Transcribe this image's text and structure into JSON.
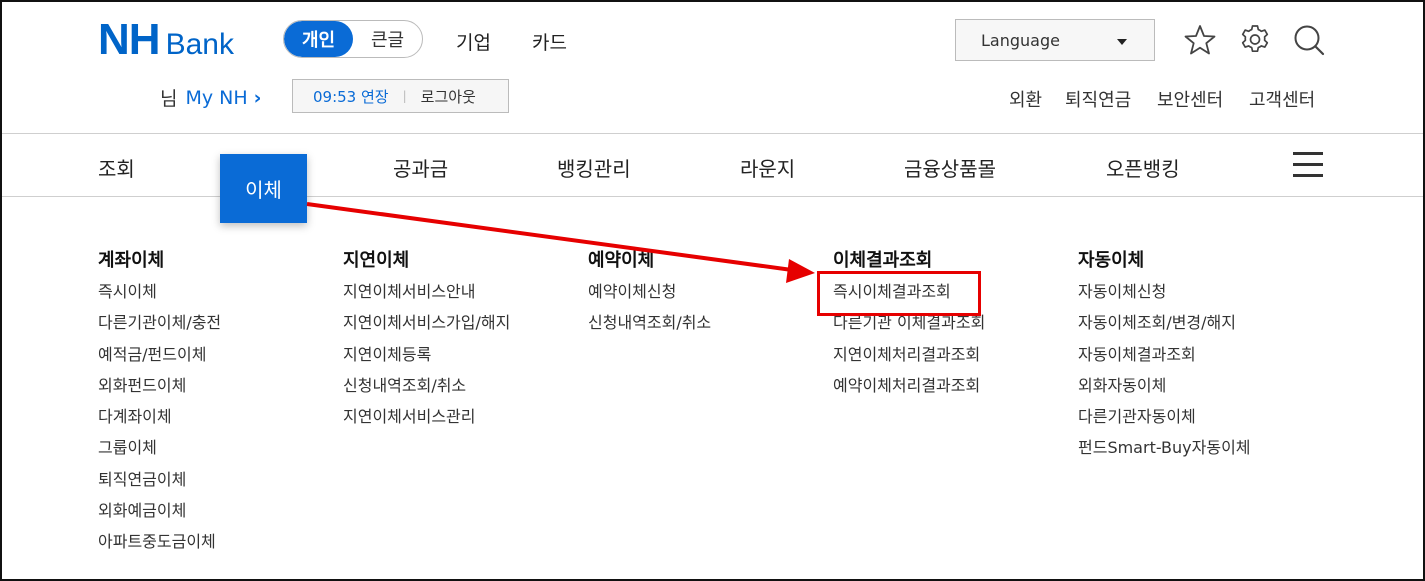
{
  "logo": {
    "nh": "NH",
    "bank": "Bank"
  },
  "mode_toggle": {
    "personal": "개인",
    "large": "큰글"
  },
  "top_links": {
    "corporate": "기업",
    "card": "카드"
  },
  "language": {
    "label": "Language"
  },
  "user": {
    "suffix": "님",
    "my_nh": "My NH",
    "chevron": "›"
  },
  "session": {
    "timer": "09:53 연장",
    "separator": "|",
    "logout": "로그아웃"
  },
  "util_links": [
    "외환",
    "퇴직연금",
    "보안센터",
    "고객센터"
  ],
  "main_nav": {
    "inquiry": "조회",
    "transfer": "이체",
    "utility": "공과금",
    "banking_mgmt": "뱅킹관리",
    "lounge": "라운지",
    "products": "금융상품몰",
    "open_banking": "오픈뱅킹"
  },
  "submenu": [
    {
      "title": "계좌이체",
      "items": [
        "즉시이체",
        "다른기관이체/충전",
        "예적금/펀드이체",
        "외화펀드이체",
        "다계좌이체",
        "그룹이체",
        "퇴직연금이체",
        "외화예금이체",
        "아파트중도금이체"
      ]
    },
    {
      "title": "지연이체",
      "items": [
        "지연이체서비스안내",
        "지연이체서비스가입/해지",
        "지연이체등록",
        "신청내역조회/취소",
        "지연이체서비스관리"
      ]
    },
    {
      "title": "예약이체",
      "items": [
        "예약이체신청",
        "신청내역조회/취소"
      ]
    },
    {
      "title": "이체결과조회",
      "items": [
        "즉시이체결과조회",
        "다른기관 이체결과조회",
        "지연이체처리결과조회",
        "예약이체처리결과조회"
      ]
    },
    {
      "title": "자동이체",
      "items": [
        "자동이체신청",
        "자동이체조회/변경/해지",
        "자동이체결과조회",
        "외화자동이체",
        "다른기관자동이체",
        "펀드Smart-Buy자동이체"
      ]
    }
  ],
  "colors": {
    "brand": "#0064c8",
    "accent": "#0a6bd6",
    "annotation": "#e60000"
  },
  "icons": [
    "star-icon",
    "gear-icon",
    "search-icon",
    "chevron-right-icon",
    "caret-down-icon",
    "hamburger-menu-icon"
  ]
}
